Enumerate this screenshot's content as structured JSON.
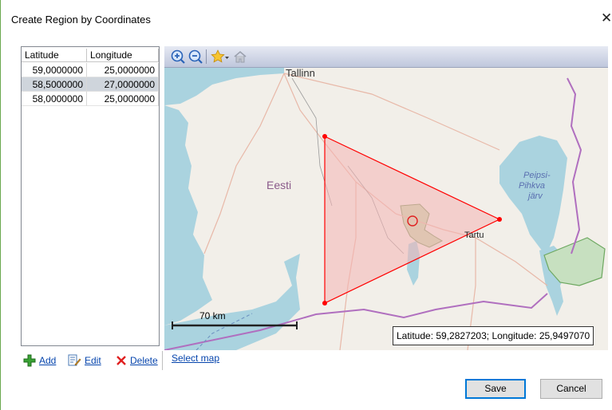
{
  "window": {
    "title": "Create Region by Coordinates",
    "close_glyph": "✕"
  },
  "grid": {
    "columns": [
      "Latitude",
      "Longitude"
    ],
    "rows": [
      {
        "lat": "59,0000000",
        "lon": "25,0000000"
      },
      {
        "lat": "58,5000000",
        "lon": "27,0000000"
      },
      {
        "lat": "58,0000000",
        "lon": "25,0000000"
      }
    ],
    "selected_row_index": 1
  },
  "actions": {
    "add": "Add",
    "edit": "Edit",
    "delete": "Delete",
    "select_map": "Select map"
  },
  "map": {
    "toolbar_icons": [
      "zoom-in-icon",
      "zoom-out-icon",
      "favorites-star-icon",
      "home-icon"
    ],
    "labels": {
      "tallinn": "Tallinn",
      "country": "Eesti",
      "lake": "Peipsi-\nPihkva\njärv",
      "tartu": "Tartu"
    },
    "scale": "70 km",
    "coordinates_readout": "Latitude: 59,2827203; Longitude: 25,9497070",
    "colors": {
      "water": "#aad3df",
      "land": "#f2efe9",
      "polygon_stroke": "#ff0000",
      "polygon_fill": "#f4b4b4",
      "border": "#b06fbf"
    }
  },
  "buttons": {
    "save": "Save",
    "cancel": "Cancel"
  }
}
